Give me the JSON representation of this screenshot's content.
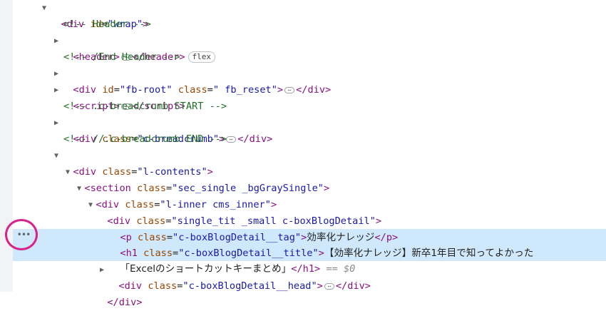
{
  "glyphs": {
    "open_tag": "<",
    "close": ">",
    "end_open": "</",
    "eq": "=",
    "quote": "\"",
    "ellipsis": "⋯",
    "gutter_dots": "•••",
    "triangle_open": "▼",
    "triangle_closed": "▶"
  },
  "lines": {
    "wrap": {
      "tag": "div",
      "attr": "id",
      "value": "wrap"
    },
    "c_header": "<!-- Header -->",
    "header": {
      "tag": "header",
      "close": "header",
      "badge": "flex"
    },
    "c_end_header": "<!-- /End Header -->",
    "fbroot": {
      "tag": "div",
      "attr1": "id",
      "value1": "fb-root",
      "attr2": "class",
      "value2": " fb_reset",
      "close": "div"
    },
    "script": {
      "tag": "script",
      "close": "script"
    },
    "c_bc_start": "<!-- .c-breadcrumb START -->",
    "breadcrumb": {
      "tag": "div",
      "attr": "class",
      "value": "c-breadcrumb",
      "close": "div"
    },
    "c_bc_end": "<!-- //.c-breadcrumb END -->",
    "lcontents": {
      "tag": "div",
      "attr": "class",
      "value": "l-contents"
    },
    "section": {
      "tag": "section",
      "attr": "class",
      "value": "sec_single _bgGraySingle"
    },
    "linner": {
      "tag": "div",
      "attr": "class",
      "value": "l-inner cms_inner"
    },
    "singletit": {
      "tag": "div",
      "attr": "class",
      "value": "single_tit _small c-boxBlogDetail"
    },
    "ptag": {
      "tag": "p",
      "attr": "class",
      "value": "c-boxBlogDetail__tag",
      "text": "効率化ナレッジ",
      "close": "p"
    },
    "h1": {
      "tag": "h1",
      "attr": "class",
      "value": "c-boxBlogDetail__title",
      "text1": "【効率化ナレッジ】新卒1年目で知ってよかった",
      "text2": "「Excelのショートカットキーまとめ」",
      "close": "h1",
      "eq_text": "== $0"
    },
    "head": {
      "tag": "div",
      "attr": "class",
      "value": "c-boxBlogDetail__head",
      "close": "div"
    },
    "enddiv": {
      "close": "div"
    }
  }
}
